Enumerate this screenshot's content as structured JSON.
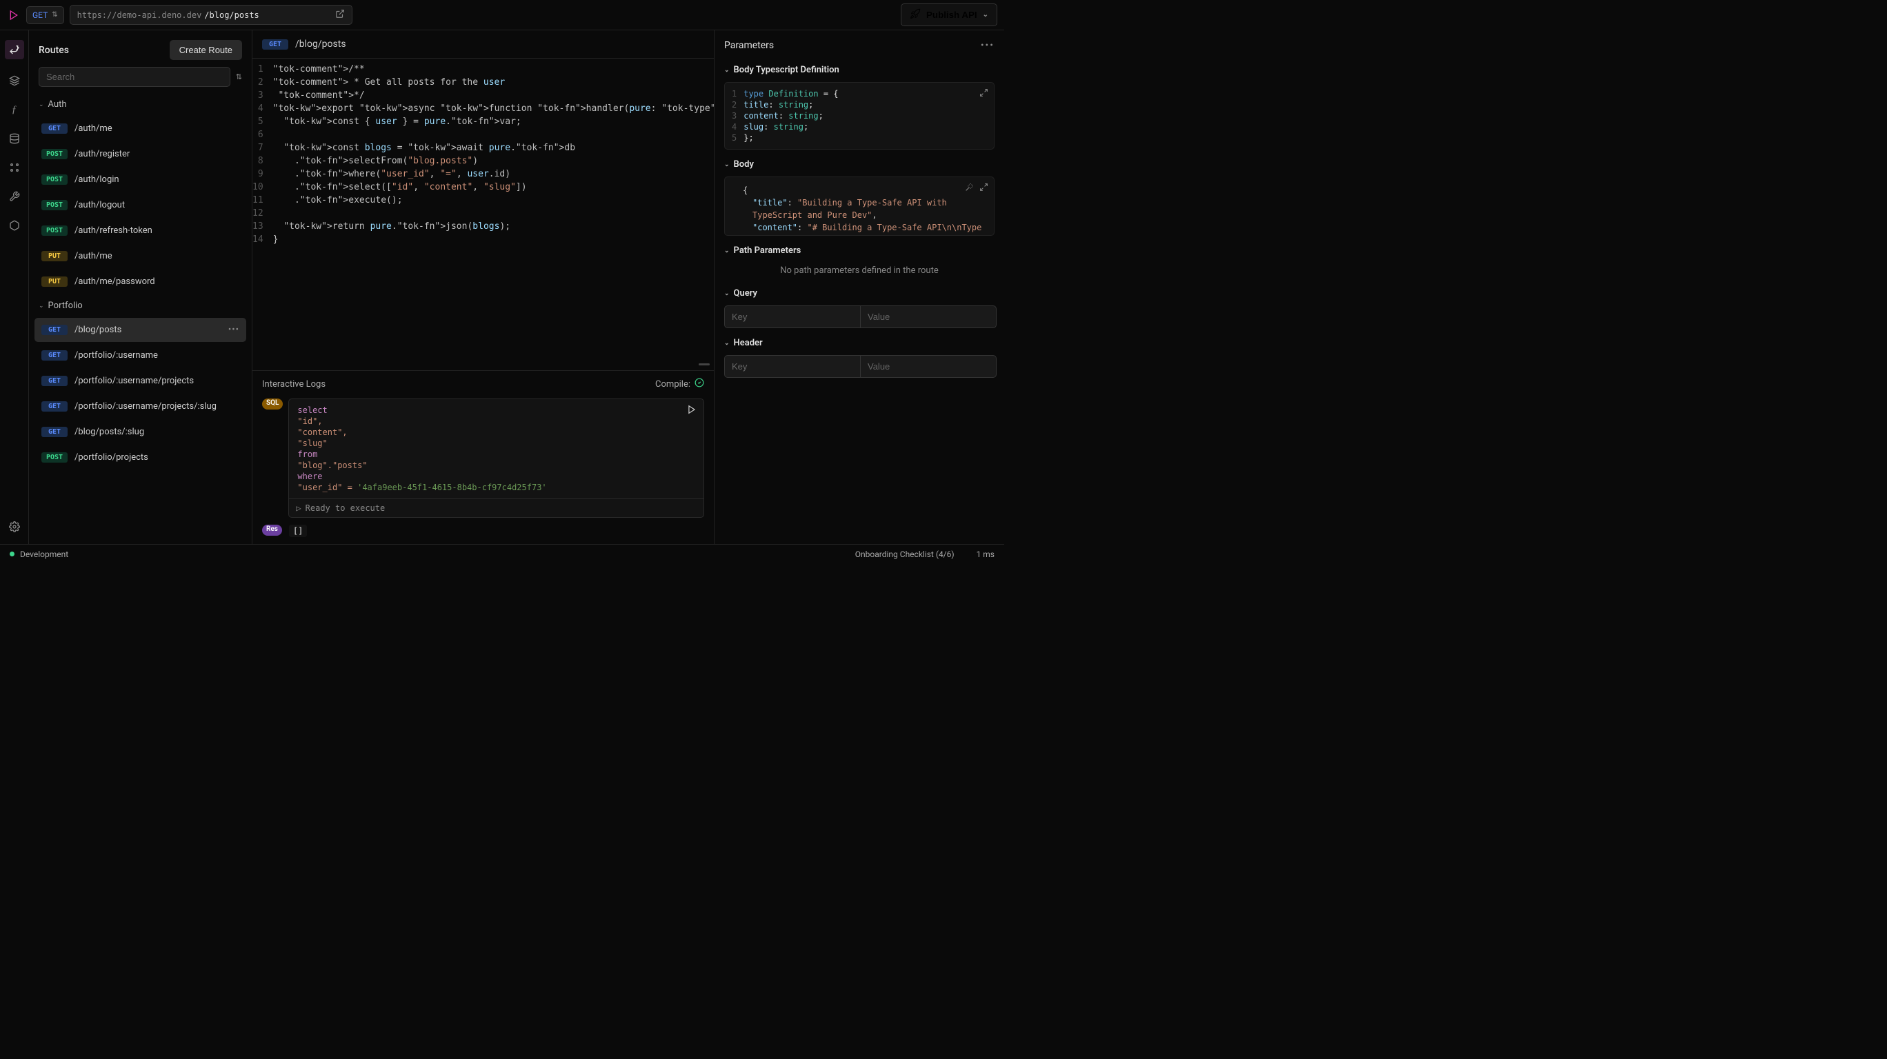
{
  "topbar": {
    "method": "GET",
    "url_base": "https://demo-api.deno.dev",
    "url_path": "/blog/posts",
    "publish_label": "Publish API"
  },
  "sidebar": {
    "title": "Routes",
    "create_label": "Create Route",
    "search_placeholder": "Search",
    "groups": [
      {
        "name": "Auth",
        "routes": [
          {
            "method": "GET",
            "path": "/auth/me"
          },
          {
            "method": "POST",
            "path": "/auth/register"
          },
          {
            "method": "POST",
            "path": "/auth/login"
          },
          {
            "method": "POST",
            "path": "/auth/logout"
          },
          {
            "method": "POST",
            "path": "/auth/refresh-token"
          },
          {
            "method": "PUT",
            "path": "/auth/me"
          },
          {
            "method": "PUT",
            "path": "/auth/me/password"
          }
        ]
      },
      {
        "name": "Portfolio",
        "routes": [
          {
            "method": "GET",
            "path": "/blog/posts",
            "active": true
          },
          {
            "method": "GET",
            "path": "/portfolio/:username"
          },
          {
            "method": "GET",
            "path": "/portfolio/:username/projects"
          },
          {
            "method": "GET",
            "path": "/portfolio/:username/projects/:slug"
          },
          {
            "method": "GET",
            "path": "/blog/posts/:slug"
          },
          {
            "method": "POST",
            "path": "/portfolio/projects"
          }
        ]
      }
    ]
  },
  "center": {
    "method": "GET",
    "path": "/blog/posts",
    "code_lines": [
      "/**",
      " * Get all posts for the user",
      " */",
      "export async function handler(pure: Pure): Promise<PureResponse> {",
      "  const { user } = pure.var;",
      "",
      "  const blogs = await pure.db",
      "    .selectFrom(\"blog.posts\")",
      "    .where(\"user_id\", \"=\", user.id)",
      "    .select([\"id\", \"content\", \"slug\"])",
      "    .execute();",
      "",
      "  return pure.json(blogs);",
      "}"
    ]
  },
  "logs": {
    "title": "Interactive Logs",
    "compile_label": "Compile:",
    "sql_badge": "SQL",
    "res_badge": "Res",
    "sql_lines": {
      "l1": "select",
      "l2": "  \"id\",",
      "l3": "  \"content\",",
      "l4": "  \"slug\"",
      "l5": "from",
      "l6": "  \"blog\".\"posts\"",
      "l7": "where",
      "l8_a": "  \"user_id\" = ",
      "l8_b": "'4afa9eeb-45f1-4615-8b4b-cf97c4d25f73'"
    },
    "ready_label": "Ready to execute",
    "res_value": "[]"
  },
  "right": {
    "title": "Parameters",
    "sections": {
      "body_def": "Body Typescript Definition",
      "body": "Body",
      "path_params": "Path Parameters",
      "path_empty": "No path parameters defined in the route",
      "query": "Query",
      "header": "Header",
      "key_placeholder": "Key",
      "value_placeholder": "Value"
    },
    "ts_def_lines": [
      "type Definition = {",
      "  title: string;",
      "  content: string;",
      "  slug: string;",
      "};"
    ],
    "body_preview": {
      "l1": "{",
      "l2_key": "\"title\"",
      "l2_val": "\"Building a Type-Safe API with TypeScript and Pure Dev\"",
      "l3_key": "\"content\"",
      "l3_val": "\"# Building a Type-Safe API\\n\\nType safety is crucial for modern"
    }
  },
  "statusbar": {
    "env": "Development",
    "checklist": "Onboarding Checklist (4/6)",
    "timing": "1 ms"
  }
}
